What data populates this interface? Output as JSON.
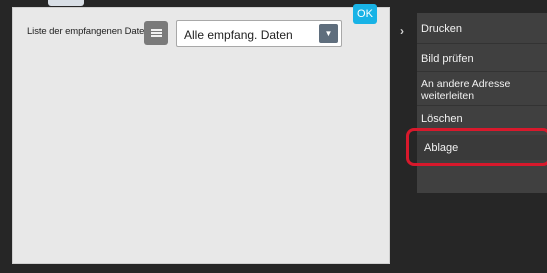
{
  "toolbar": {
    "list_label": "Liste der empfangenen Daten",
    "filter_value": "Alle empfang. Daten",
    "ok_label": "OK"
  },
  "action_panel": {
    "items": [
      {
        "label": "Drucken"
      },
      {
        "label": "Bild prüfen"
      },
      {
        "label": "An andere Adresse weiterleiten"
      },
      {
        "label": "Löschen"
      },
      {
        "label": "Ablage"
      }
    ],
    "highlighted_item": "Ablage"
  },
  "colors": {
    "ok_button": "#18b3e6",
    "highlight_border": "#d8192c",
    "panel_bg": "#404040"
  }
}
